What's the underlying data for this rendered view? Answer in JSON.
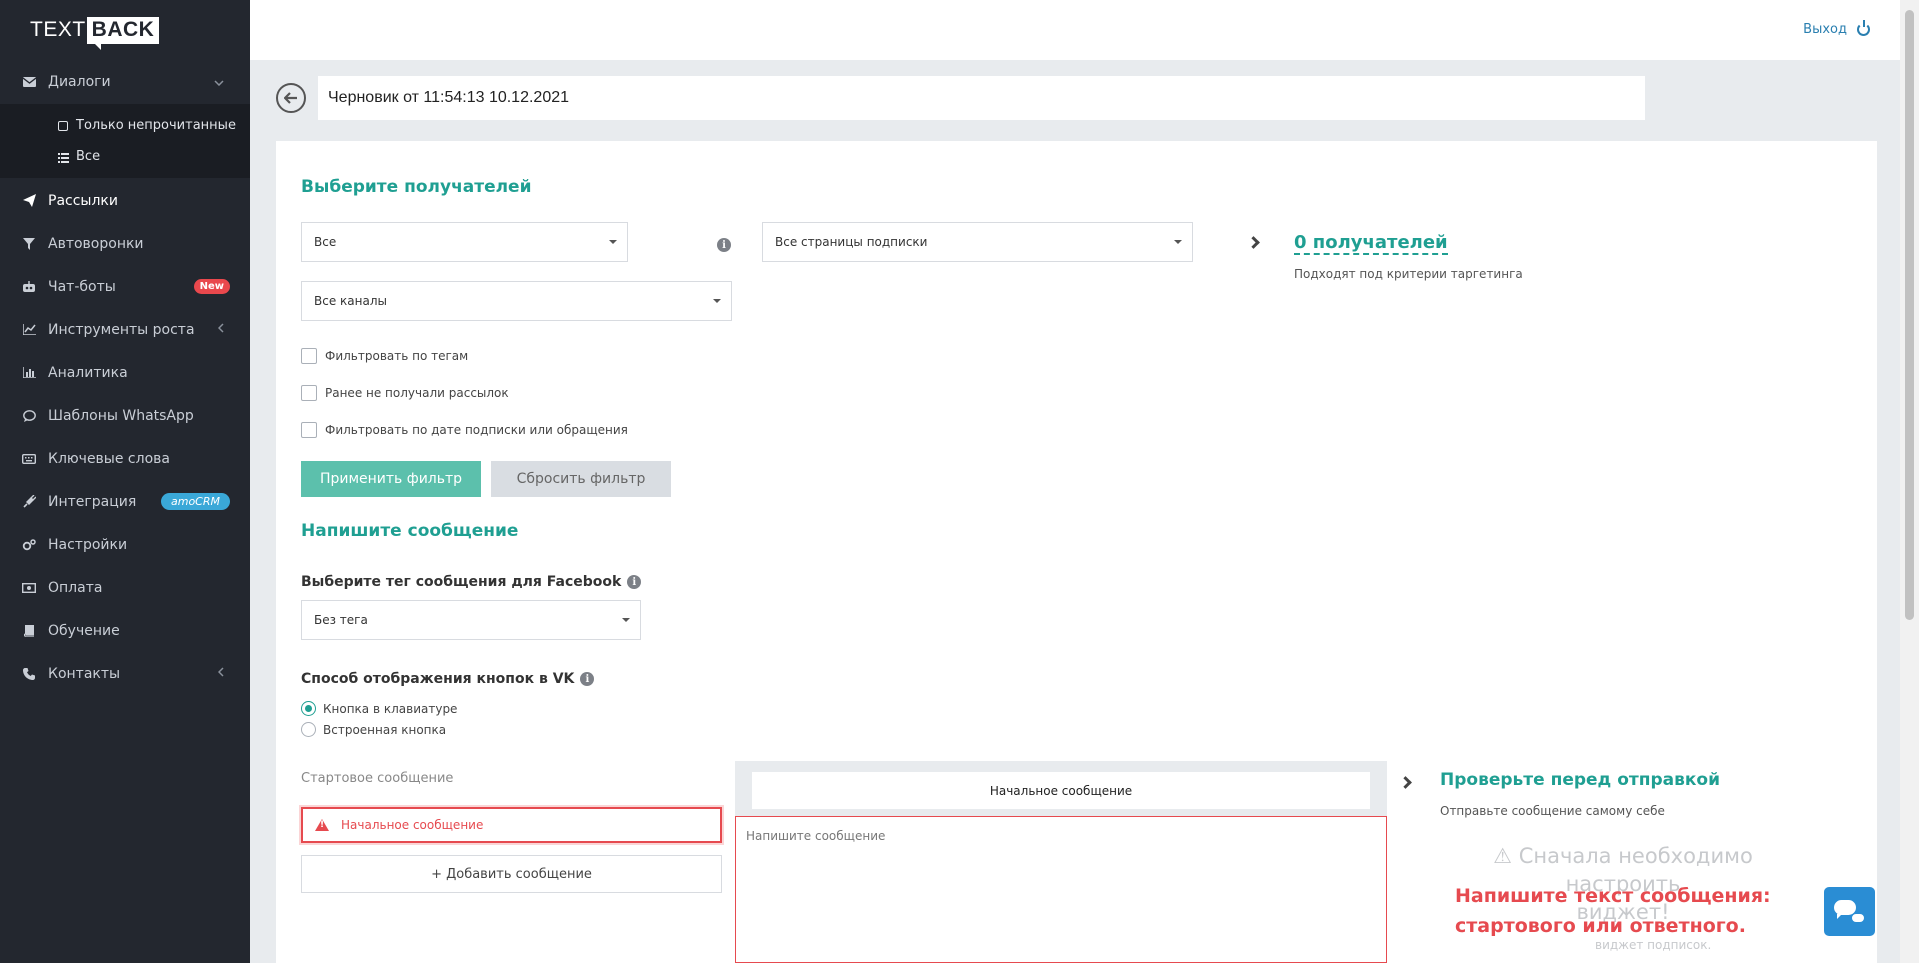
{
  "brand": {
    "left": "TEXT",
    "right": "BACK"
  },
  "topbar": {
    "logout_label": "Выход"
  },
  "sidebar": {
    "dialogs": {
      "label": "Диалоги",
      "sub": [
        "Только непрочитанные",
        "Все"
      ]
    },
    "items": [
      {
        "label": "Рассылки"
      },
      {
        "label": "Автоворонки"
      },
      {
        "label": "Чат-боты",
        "badge": "New"
      },
      {
        "label": "Инструменты роста"
      },
      {
        "label": "Аналитика"
      },
      {
        "label": "Шаблоны WhatsApp"
      },
      {
        "label": "Ключевые слова"
      },
      {
        "label": "Интеграция",
        "badge": "amoCRM"
      },
      {
        "label": "Настройки"
      },
      {
        "label": "Оплата"
      },
      {
        "label": "Обучение"
      },
      {
        "label": "Контакты"
      }
    ]
  },
  "draft": {
    "title_value": "Черновик от 11:54:13 10.12.2021"
  },
  "recipients": {
    "heading": "Выберите получателей",
    "audience_select": "Все",
    "pages_select": "Все страницы подписки",
    "channels_select": "Все каналы",
    "filters": [
      "Фильтровать по тегам",
      "Ранее не получали рассылок",
      "Фильтровать по дате подписки или обращения"
    ],
    "apply_button": "Применить фильтр",
    "reset_button": "Сбросить фильтр",
    "count_link": "0 получателей",
    "count_note": "Подходят под критерии таргетинга"
  },
  "message": {
    "heading": "Напишите сообщение",
    "fb_tag_label": "Выберите тег сообщения для Facebook",
    "fb_tag_select": "Без тега",
    "vk_label": "Способ отображения кнопок в VK",
    "vk_options": [
      "Кнопка в клавиатуре",
      "Встроенная кнопка"
    ],
    "start_label": "Стартовое сообщение",
    "initial_message": "Начальное сообщение",
    "add_message": "+ Добавить сообщение",
    "editor_tab": "Начальное сообщение",
    "editor_placeholder": "Напишите сообщение"
  },
  "preview": {
    "heading": "Проверьте перед отправкой",
    "subheading": "Отправьте сообщение самому себе",
    "warning_line1": "Сначала необходимо настроить",
    "warning_line2": "виджет!",
    "warning_small": "виджет подписок.",
    "red_note_line1": "Напишите текст сообщения:",
    "red_note_line2": "стартового или ответного."
  },
  "colors": {
    "accent": "#1f9f92",
    "sidebar": "#23272f",
    "error": "#e64a4f",
    "link": "#2a7fb0"
  }
}
